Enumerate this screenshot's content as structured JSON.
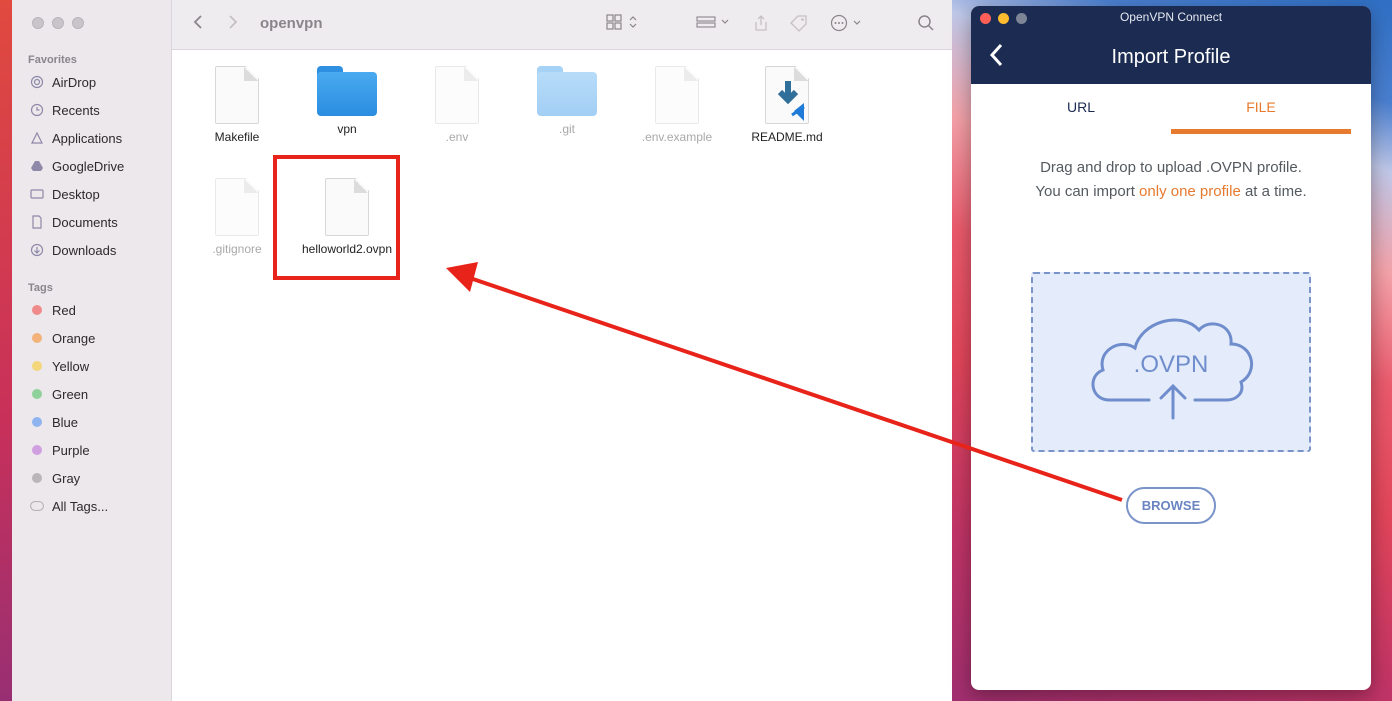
{
  "finder": {
    "path_title": "openvpn",
    "sidebar": {
      "favorites_header": "Favorites",
      "favorites": [
        {
          "label": "AirDrop",
          "icon": "airdrop-icon"
        },
        {
          "label": "Recents",
          "icon": "clock-icon"
        },
        {
          "label": "Applications",
          "icon": "applications-icon"
        },
        {
          "label": "GoogleDrive",
          "icon": "google-drive-icon"
        },
        {
          "label": "Desktop",
          "icon": "desktop-icon"
        },
        {
          "label": "Documents",
          "icon": "document-icon"
        },
        {
          "label": "Downloads",
          "icon": "download-icon"
        }
      ],
      "tags_header": "Tags",
      "tags": [
        {
          "label": "Red",
          "color": "#f08a8a"
        },
        {
          "label": "Orange",
          "color": "#f3b27a"
        },
        {
          "label": "Yellow",
          "color": "#f3d77a"
        },
        {
          "label": "Green",
          "color": "#8fd19a"
        },
        {
          "label": "Blue",
          "color": "#8fb4ef"
        },
        {
          "label": "Purple",
          "color": "#cf9fe0"
        },
        {
          "label": "Gray",
          "color": "#b8b6b8"
        }
      ],
      "all_tags": "All Tags..."
    },
    "files": [
      {
        "name": "Makefile",
        "kind": "document",
        "dimmed": false
      },
      {
        "name": "vpn",
        "kind": "folder",
        "dimmed": false
      },
      {
        "name": ".env",
        "kind": "document",
        "dimmed": true
      },
      {
        "name": ".git",
        "kind": "folder",
        "dimmed": true
      },
      {
        "name": ".env.example",
        "kind": "document",
        "dimmed": true
      },
      {
        "name": "README.md",
        "kind": "vscode-document",
        "dimmed": false
      },
      {
        "name": ".gitignore",
        "kind": "document",
        "dimmed": true
      },
      {
        "name": "helloworld2.ovpn",
        "kind": "document",
        "dimmed": false
      }
    ]
  },
  "ovpn": {
    "window_title": "OpenVPN Connect",
    "header_title": "Import Profile",
    "tabs": {
      "url": "URL",
      "file": "FILE"
    },
    "instruction_line1": "Drag and drop to upload .OVPN profile.",
    "instruction_line2_pre": "You can import ",
    "instruction_line2_accent": "only one profile",
    "instruction_line2_post": " at a time.",
    "dropzone_label": ".OVPN",
    "browse_label": "BROWSE",
    "colors": {
      "header": "#1b2b52",
      "accent": "#e67a2e",
      "dropzone": "#e4ecfb",
      "outline": "#7a93c8"
    }
  },
  "annotation": {
    "highlight_color": "#e8231a"
  }
}
